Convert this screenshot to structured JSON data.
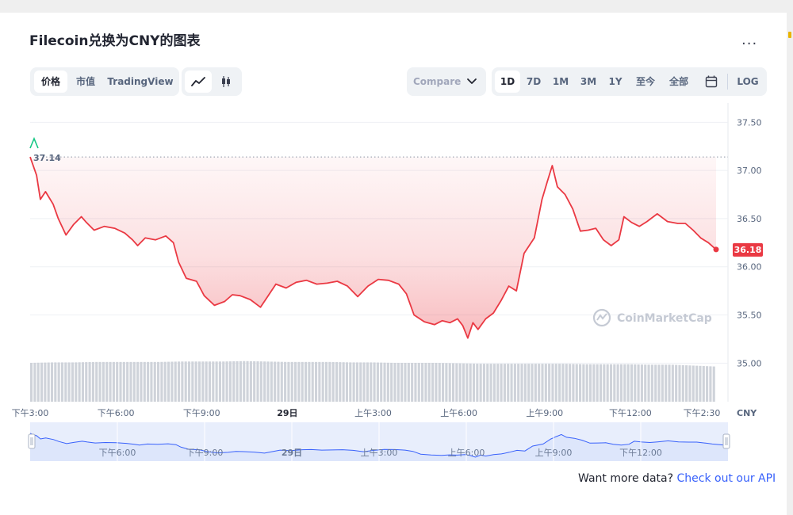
{
  "header": {
    "title": "Filecoin兑换为CNY的图表",
    "more_label": "..."
  },
  "toolbar": {
    "metric_tabs": [
      "价格",
      "市值",
      "TradingView"
    ],
    "active_metric": "价格",
    "compare_label": "Compare",
    "ranges": [
      "1D",
      "7D",
      "1M",
      "3M",
      "1Y",
      "至今",
      "全部"
    ],
    "active_range": "1D",
    "log_label": "LOG"
  },
  "icons": {
    "line_chart": "line-chart-icon",
    "candlestick": "candlestick-icon",
    "calendar": "calendar-icon",
    "compare_dropdown": "chevron-down-icon",
    "watermark_logo": "coinmarketcap-logo-icon"
  },
  "watermark": "CoinMarketCap",
  "colors": {
    "line": "#ea3943",
    "price_badge": "#ea3943",
    "fill_top": "#ea3943",
    "volume_bar": "#cfd3da",
    "navigator_fill": "#e8eefc",
    "navigator_line": "#3861fb",
    "open_marker": "#16c784",
    "link": "#3861fb"
  },
  "chart_data": {
    "type": "area",
    "title": "Filecoin兑换为CNY的图表",
    "xlabel": "",
    "ylabel": "",
    "currency": "CNY",
    "ylim": [
      34.6,
      37.7
    ],
    "y_ticks": [
      "37.50",
      "37.00",
      "36.50",
      "36.00",
      "35.50",
      "35.00"
    ],
    "x_ticks": [
      "下午3:00",
      "下午6:00",
      "下午9:00",
      "29日",
      "上午3:00",
      "上午6:00",
      "上午9:00",
      "下午12:00",
      "下午2:30"
    ],
    "x_tick_hours": [
      0,
      3,
      6,
      9,
      12,
      15,
      18,
      21,
      23.5
    ],
    "x_range_hours": [
      0,
      24
    ],
    "open_price": 37.14,
    "open_price_label": "37.14",
    "last_price": 36.18,
    "last_price_label": "36.18",
    "price_series": [
      [
        0.0,
        37.14
      ],
      [
        0.25,
        36.95
      ],
      [
        0.4,
        36.7
      ],
      [
        0.6,
        36.78
      ],
      [
        0.9,
        36.65
      ],
      [
        1.1,
        36.5
      ],
      [
        1.4,
        36.33
      ],
      [
        1.7,
        36.44
      ],
      [
        2.0,
        36.52
      ],
      [
        2.2,
        36.46
      ],
      [
        2.5,
        36.38
      ],
      [
        2.9,
        36.42
      ],
      [
        3.3,
        36.4
      ],
      [
        3.7,
        36.35
      ],
      [
        4.0,
        36.28
      ],
      [
        4.2,
        36.22
      ],
      [
        4.5,
        36.3
      ],
      [
        4.9,
        36.28
      ],
      [
        5.3,
        36.32
      ],
      [
        5.6,
        36.25
      ],
      [
        5.8,
        36.05
      ],
      [
        6.1,
        35.88
      ],
      [
        6.5,
        35.85
      ],
      [
        6.8,
        35.7
      ],
      [
        7.2,
        35.6
      ],
      [
        7.6,
        35.64
      ],
      [
        7.9,
        35.71
      ],
      [
        8.2,
        35.7
      ],
      [
        8.6,
        35.66
      ],
      [
        9.0,
        35.58
      ],
      [
        9.3,
        35.7
      ],
      [
        9.6,
        35.82
      ],
      [
        10.0,
        35.78
      ],
      [
        10.4,
        35.84
      ],
      [
        10.8,
        35.86
      ],
      [
        11.2,
        35.82
      ],
      [
        11.6,
        35.83
      ],
      [
        12.0,
        35.85
      ],
      [
        12.4,
        35.8
      ],
      [
        12.8,
        35.69
      ],
      [
        13.2,
        35.8
      ],
      [
        13.6,
        35.87
      ],
      [
        14.0,
        35.86
      ],
      [
        14.4,
        35.82
      ],
      [
        14.7,
        35.72
      ],
      [
        15.0,
        35.5
      ],
      [
        15.4,
        35.43
      ],
      [
        15.8,
        35.4
      ],
      [
        16.1,
        35.44
      ],
      [
        16.4,
        35.42
      ],
      [
        16.7,
        35.46
      ],
      [
        16.9,
        35.39
      ],
      [
        17.1,
        35.26
      ],
      [
        17.3,
        35.42
      ],
      [
        17.5,
        35.35
      ],
      [
        17.8,
        35.46
      ],
      [
        18.1,
        35.52
      ],
      [
        18.4,
        35.65
      ],
      [
        18.7,
        35.8
      ],
      [
        19.0,
        35.75
      ],
      [
        19.3,
        36.14
      ],
      [
        19.7,
        36.3
      ],
      [
        20.0,
        36.7
      ],
      [
        20.2,
        36.88
      ],
      [
        20.4,
        37.05
      ],
      [
        20.6,
        36.83
      ],
      [
        20.9,
        36.75
      ],
      [
        21.2,
        36.6
      ],
      [
        21.5,
        36.37
      ],
      [
        21.8,
        36.38
      ],
      [
        22.1,
        36.4
      ],
      [
        22.4,
        36.28
      ],
      [
        22.7,
        36.22
      ],
      [
        23.0,
        36.28
      ],
      [
        23.2,
        36.52
      ],
      [
        23.5,
        36.46
      ],
      [
        23.8,
        36.42
      ],
      [
        24.1,
        36.47
      ],
      [
        24.5,
        36.55
      ],
      [
        24.9,
        36.47
      ],
      [
        25.3,
        36.45
      ],
      [
        25.6,
        36.45
      ],
      [
        25.9,
        36.38
      ],
      [
        26.2,
        36.3
      ],
      [
        26.5,
        36.25
      ],
      [
        26.8,
        36.18
      ]
    ],
    "volume_levels": [
      0.86,
      0.87,
      0.87,
      0.88,
      0.88,
      0.88,
      0.88,
      0.89,
      0.89,
      0.89,
      0.9,
      0.89,
      0.88,
      0.88,
      0.88,
      0.87,
      0.87,
      0.86,
      0.86,
      0.86,
      0.85,
      0.84,
      0.84,
      0.84,
      0.84,
      0.84,
      0.83,
      0.83,
      0.83,
      0.82,
      0.82,
      0.8,
      0.78
    ]
  },
  "navigator": {
    "ticks": [
      "下午6:00",
      "下午9:00",
      "29日",
      "上午3:00",
      "上午6:00",
      "上午9:00",
      "下午12:00"
    ],
    "tick_hours": [
      3,
      6,
      9,
      12,
      15,
      18,
      21
    ]
  },
  "footer": {
    "prompt": "Want more data?",
    "link": "Check out our API"
  }
}
